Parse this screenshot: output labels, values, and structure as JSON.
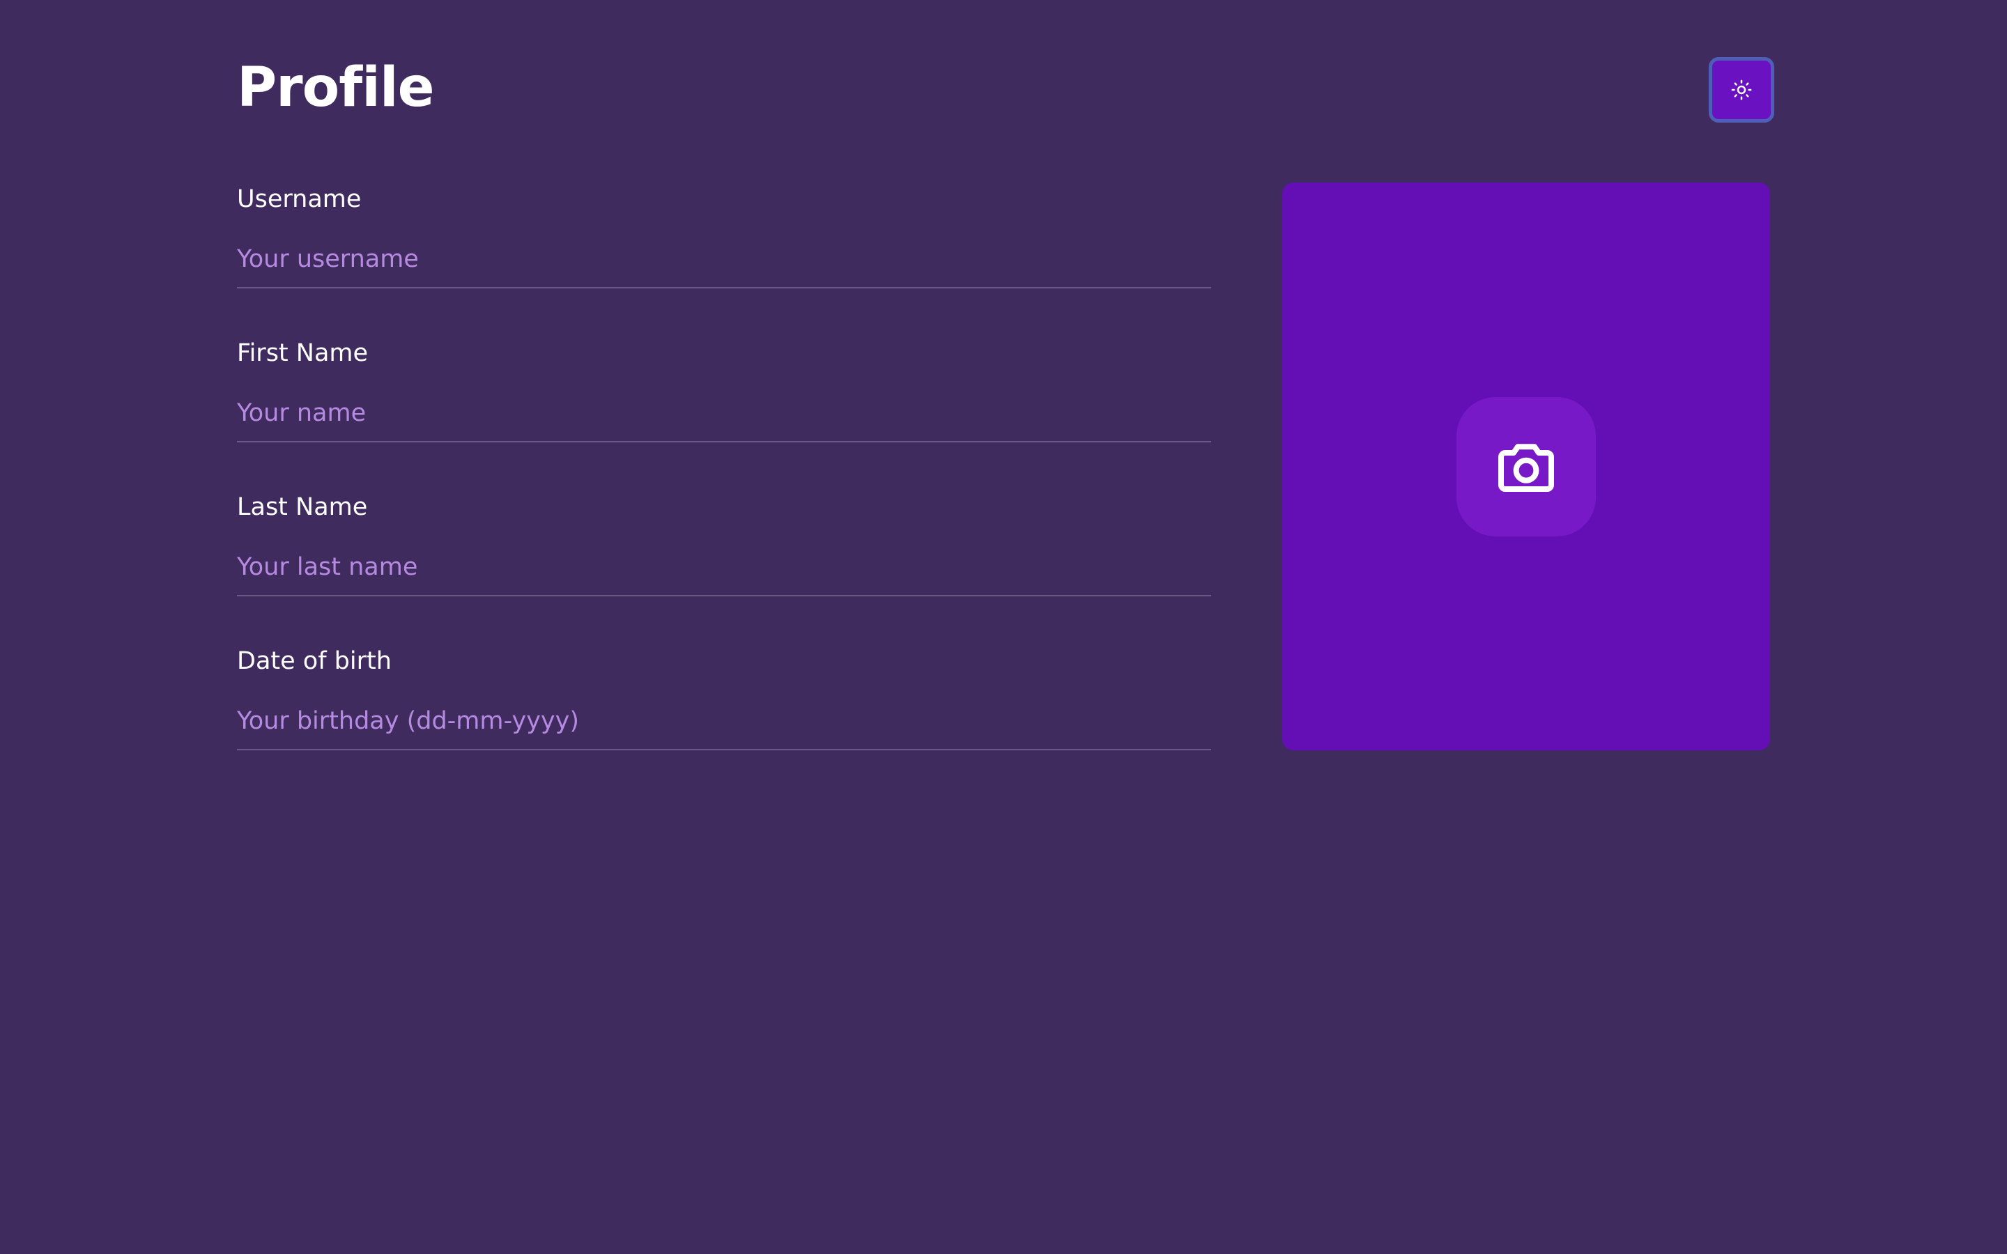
{
  "header": {
    "title": "Profile",
    "theme_toggle_icon": "sun-icon"
  },
  "form": {
    "fields": [
      {
        "label": "Username",
        "value": "",
        "placeholder": "Your username"
      },
      {
        "label": "First Name",
        "value": "",
        "placeholder": "Your name"
      },
      {
        "label": "Last Name",
        "value": "",
        "placeholder": "Your last name"
      },
      {
        "label": "Date of birth",
        "value": "",
        "placeholder": "Your birthday (dd-mm-yyyy)"
      }
    ]
  },
  "photo": {
    "upload_icon": "camera-icon"
  },
  "colors": {
    "background": "#3f2b5e",
    "accent": "#640fb6",
    "placeholder": "#b58ae0",
    "toggle_border": "#4f5fb8"
  }
}
